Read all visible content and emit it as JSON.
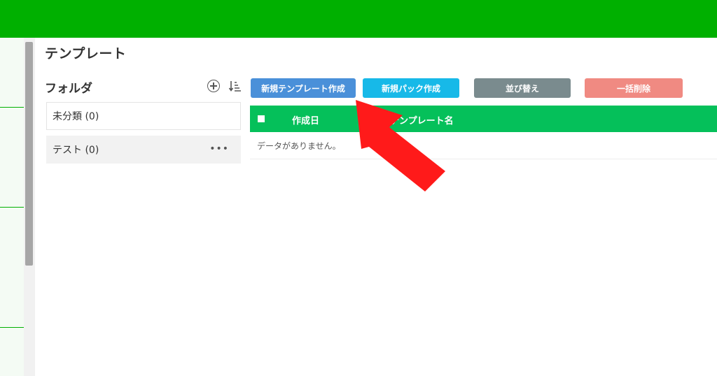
{
  "page": {
    "title": "テンプレート"
  },
  "folders": {
    "heading": "フォルダ",
    "items": [
      {
        "label": "未分類 (0)"
      },
      {
        "label": "テスト (0)",
        "more": "•••"
      }
    ]
  },
  "toolbar": {
    "new_template": "新規テンプレート作成",
    "new_pack": "新規パック作成",
    "sort": "並び替え",
    "bulk_delete": "一括削除"
  },
  "table": {
    "columns": [
      "作成日",
      "テンプレート名"
    ],
    "empty_message": "データがありません。"
  },
  "colors": {
    "topbar": "#00b000",
    "table_header": "#05c05a",
    "arrow": "#ff1a1a"
  },
  "icons": [
    "add-folder-icon",
    "sort-icon",
    "more-icon",
    "pointer-arrow"
  ]
}
